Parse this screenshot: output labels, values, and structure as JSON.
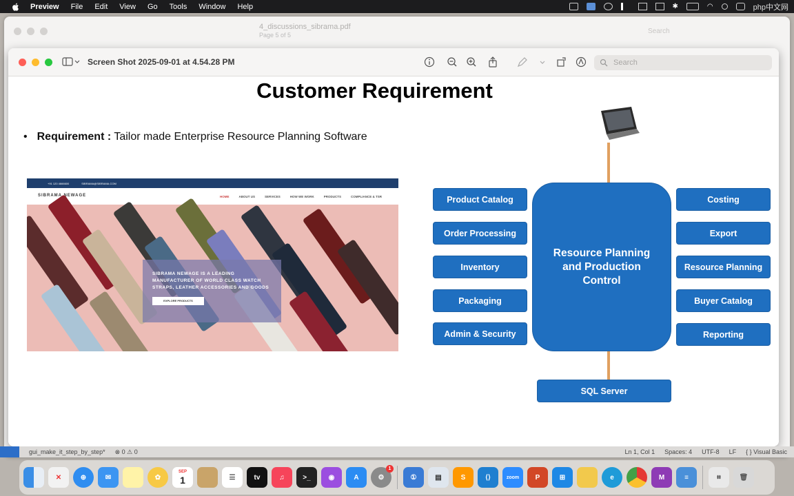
{
  "menubar": {
    "app": "Preview",
    "items": [
      "File",
      "Edit",
      "View",
      "Go",
      "Tools",
      "Window",
      "Help"
    ],
    "watermark": "php中文网"
  },
  "back_window": {
    "title": "4_discussions_sibrama.pdf",
    "subtitle": "Page 5 of 5",
    "search_placeholder": "Search"
  },
  "front_window": {
    "title": "Screen Shot 2025-09-01 at 4.54.28 PM",
    "search_placeholder": "Search"
  },
  "slide": {
    "title": "Customer Requirement",
    "bullet_label": "Requirement :",
    "bullet_text": "Tailor made Enterprise Resource Planning Software",
    "website": {
      "topbar_phone": "+91 120 4666600",
      "topbar_email": "SIBRAMA@SIBRAMA.COM",
      "logo": "SIBRAMA NEWAGE",
      "nav": [
        "HOME",
        "ABOUT US",
        "SERVICES",
        "HOW WE WORK",
        "PRODUCTS",
        "COMPLIANCE & TSR"
      ],
      "hero_text": "SIBRAMA NEWAGE IS A LEADING MANUFACTURER OF WORLD CLASS WATCH STRAPS, LEATHER ACCESSORIES AND GOODS",
      "hero_button": "EXPLORE PRODUCTS"
    },
    "diagram": {
      "left_boxes": [
        "Product Catalog",
        "Order Processing",
        "Inventory",
        "Packaging",
        "Admin & Security"
      ],
      "right_boxes": [
        "Costing",
        "Export",
        "Resource Planning",
        "Buyer Catalog",
        "Reporting"
      ],
      "center": "Resource Planning and Production Control",
      "bottom": "SQL Server"
    }
  },
  "status_bar": {
    "branch": "gui_make_it_step_by_step*",
    "problems": "⊗ 0 ⚠ 0",
    "position": "Ln 1, Col 1",
    "spaces": "Spaces: 4",
    "encoding": "UTF-8",
    "eol": "LF",
    "language": "{ } Visual Basic"
  },
  "dock": {
    "icons": [
      "finder-icon",
      "launchpad-icon",
      "safari-icon",
      "mail-icon",
      "notes-icon",
      "photos-icon",
      "calendar-icon",
      "box-icon",
      "reminders-icon",
      "appletv-icon",
      "music-icon",
      "terminal-icon",
      "podcasts-icon",
      "appstore-icon",
      "settings-icon",
      "onepassword-icon",
      "preview-icon",
      "sublime-icon",
      "vscode-icon",
      "zoom-icon",
      "powerpoint-icon",
      "windows-icon",
      "folder-icon",
      "edge-icon",
      "chrome-icon",
      "maple-icon",
      "notes2-icon",
      "screenshot-icon",
      "trash-icon"
    ],
    "calendar_day": "1",
    "calendar_month": "SEP",
    "zoom_label": "zoom",
    "settings_badge": "1"
  }
}
